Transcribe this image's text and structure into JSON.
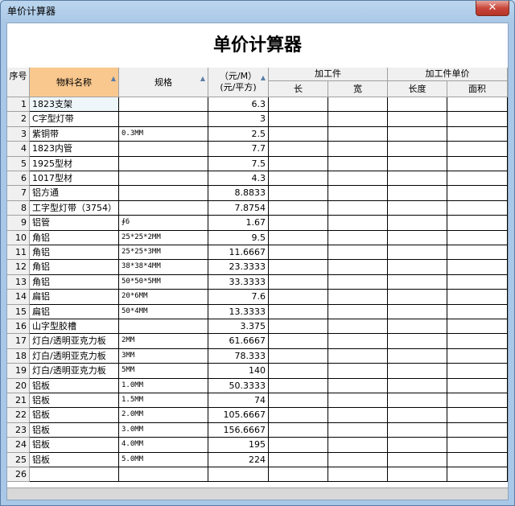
{
  "window": {
    "title": "单价计算器",
    "close_label": "✕"
  },
  "heading": "单价计算器",
  "headers": {
    "seq": "序号",
    "name": "物料名称",
    "spec": "规格",
    "price_top": "（元/M）",
    "price_bottom": "(元/平方)",
    "workpiece": "加工件",
    "length": "长",
    "width": "宽",
    "workpiece_price": "加工件单价",
    "len_degree": "长度",
    "area": "面积",
    "sort_icon": "▲"
  },
  "rows": [
    {
      "n": "1",
      "name": "1823支架",
      "spec": "",
      "price": "6.3"
    },
    {
      "n": "2",
      "name": "C字型灯带",
      "spec": "",
      "price": "3"
    },
    {
      "n": "3",
      "name": "紫铜带",
      "spec": "0.3MM",
      "price": "2.5"
    },
    {
      "n": "4",
      "name": "1823内管",
      "spec": "",
      "price": "7.7"
    },
    {
      "n": "5",
      "name": "1925型材",
      "spec": "",
      "price": "7.5"
    },
    {
      "n": "6",
      "name": "1017型材",
      "spec": "",
      "price": "4.3"
    },
    {
      "n": "7",
      "name": "铝方通",
      "spec": "",
      "price": "8.8833"
    },
    {
      "n": "8",
      "name": "工字型灯带（3754）",
      "spec": "",
      "price": "7.8754"
    },
    {
      "n": "9",
      "name": "铝管",
      "spec": "∮6",
      "price": "1.67"
    },
    {
      "n": "10",
      "name": "角铝",
      "spec": "25*25*2MM",
      "price": "9.5"
    },
    {
      "n": "11",
      "name": "角铝",
      "spec": "25*25*3MM",
      "price": "11.6667"
    },
    {
      "n": "12",
      "name": "角铝",
      "spec": "38*38*4MM",
      "price": "23.3333"
    },
    {
      "n": "13",
      "name": "角铝",
      "spec": "50*50*5MM",
      "price": "33.3333"
    },
    {
      "n": "14",
      "name": "扁铝",
      "spec": "20*6MM",
      "price": "7.6"
    },
    {
      "n": "15",
      "name": "扁铝",
      "spec": "50*4MM",
      "price": "13.3333"
    },
    {
      "n": "16",
      "name": "山字型胶槽",
      "spec": "",
      "price": "3.375"
    },
    {
      "n": "17",
      "name": "灯白/透明亚克力板",
      "spec": "2MM",
      "price": "61.6667"
    },
    {
      "n": "18",
      "name": "灯白/透明亚克力板",
      "spec": "3MM",
      "price": "78.333"
    },
    {
      "n": "19",
      "name": "灯白/透明亚克力板",
      "spec": "5MM",
      "price": "140"
    },
    {
      "n": "20",
      "name": "铝板",
      "spec": "1.0MM",
      "price": "50.3333"
    },
    {
      "n": "21",
      "name": "铝板",
      "spec": "1.5MM",
      "price": "74"
    },
    {
      "n": "22",
      "name": "铝板",
      "spec": "2.0MM",
      "price": "105.6667"
    },
    {
      "n": "23",
      "name": "铝板",
      "spec": "3.0MM",
      "price": "156.6667"
    },
    {
      "n": "24",
      "name": "铝板",
      "spec": "4.0MM",
      "price": "195"
    },
    {
      "n": "25",
      "name": "铝板",
      "spec": "5.0MM",
      "price": "224"
    },
    {
      "n": "26",
      "name": "",
      "spec": "",
      "price": ""
    }
  ]
}
